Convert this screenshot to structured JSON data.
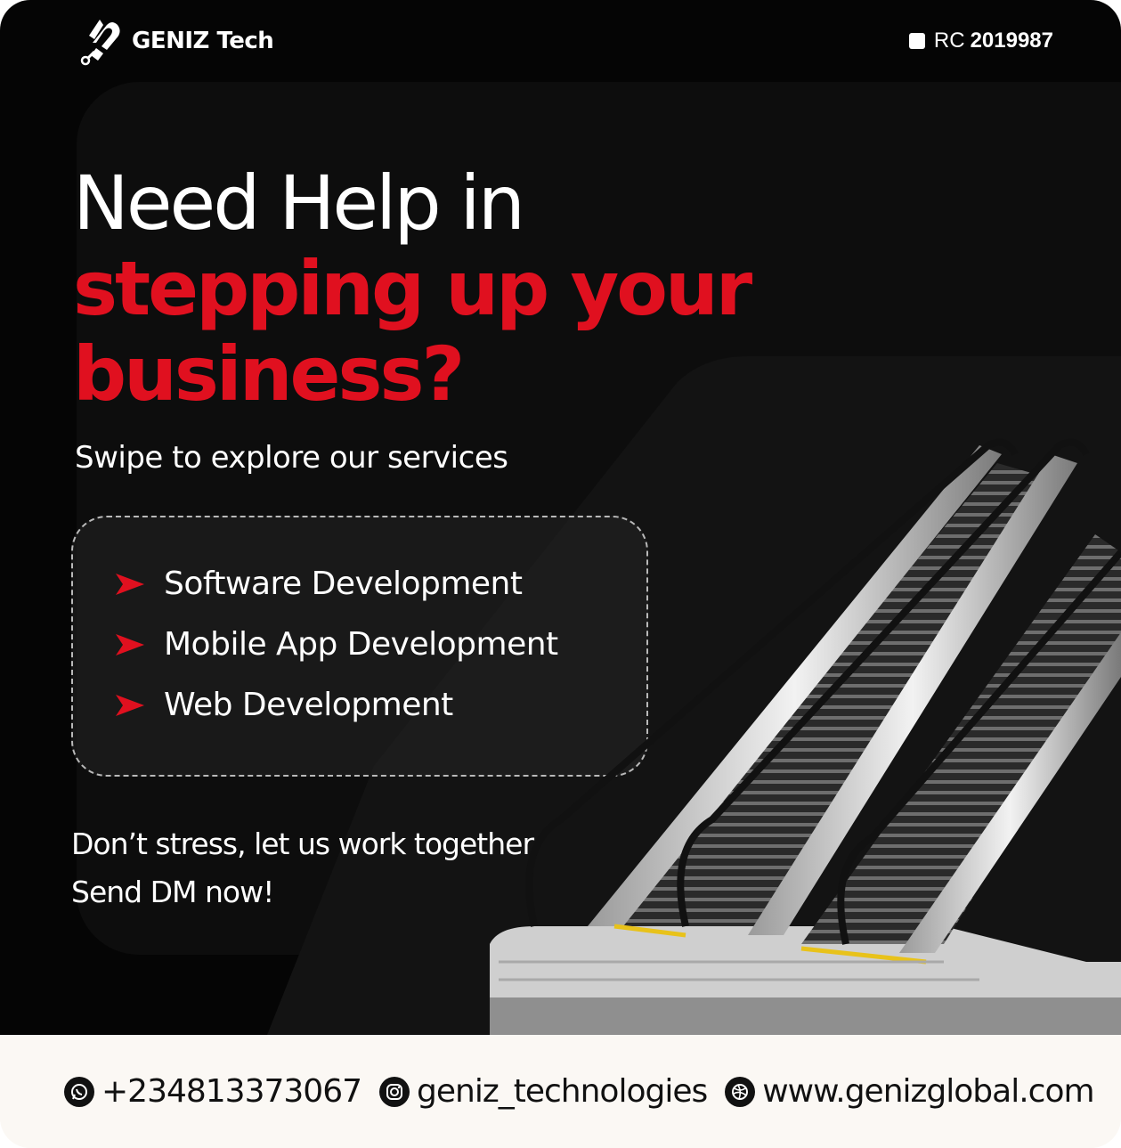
{
  "brand": {
    "name": "GENIZ Tech",
    "rc_label": "RC",
    "rc_number": "2019987"
  },
  "headline": {
    "line1": "Need Help in",
    "line2": "stepping up your",
    "line3": "business?"
  },
  "subtitle": "Swipe to explore our services",
  "services": [
    {
      "label": "Software Development"
    },
    {
      "label": "Mobile App Development"
    },
    {
      "label": "Web Development"
    }
  ],
  "cta": {
    "line1": "Don’t stress, let us work together",
    "line2": "Send DM now!"
  },
  "contacts": {
    "phone": "+2348133730 67",
    "phone_text": "+2348133730​67",
    "instagram": "geniz_technologies",
    "website": "www.genizglobal.com"
  },
  "icons": {
    "bullet": "red-arrow-icon",
    "phone": "whatsapp-icon",
    "instagram": "instagram-icon",
    "website": "globe-icon"
  },
  "colors": {
    "background": "#050505",
    "accent": "#e0101f",
    "text": "#ffffff",
    "footer_background": "#fbf8f4",
    "footer_text": "#111111"
  }
}
